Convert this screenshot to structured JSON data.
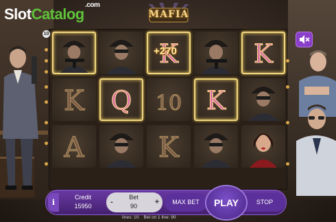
{
  "brand": {
    "part1": "Slot",
    "part2": "Catalog",
    "suffix": ".com"
  },
  "game": {
    "title": "MAFIA"
  },
  "lines_badge": "10",
  "win_popup": "+270",
  "reels": [
    [
      "gangster-tommygun",
      "K",
      "A"
    ],
    [
      "gangster-masked",
      "Q",
      "gangster-masked"
    ],
    [
      "K",
      "10",
      "K"
    ],
    [
      "gangster-tommygun",
      "K",
      "gangster-masked"
    ],
    [
      "K",
      "gangster-masked",
      "lady"
    ]
  ],
  "highlighted": [
    "0-0",
    "1-1",
    "2-0",
    "3-1",
    "4-0"
  ],
  "controls": {
    "info_label": "i",
    "credit_label": "Credit",
    "credit_value": "15950",
    "bet_label": "Bet",
    "bet_value": "90",
    "minus_label": "-",
    "plus_label": "+",
    "maxbet_label": "MAX BET",
    "play_label": "PLAY",
    "stop_label": "STOP"
  },
  "footer": {
    "lines_text": "lines: 10.",
    "bet_line_text": "Bet on 1 line: 90"
  },
  "icons": [
    "mute-icon",
    "info-icon"
  ],
  "colors": {
    "accent": "#5b309a",
    "highlight": "#f0d680",
    "brand_green": "#5fc23a"
  }
}
